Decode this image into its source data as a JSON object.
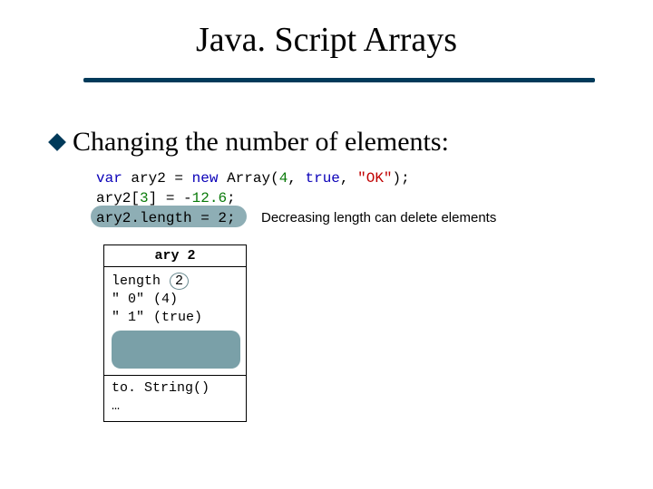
{
  "title": "Java. Script Arrays",
  "bullet": "Changing the number of elements:",
  "code": {
    "kw_var": "var",
    "id_ary2": "ary2",
    "assign": " = ",
    "kw_new": "new",
    "sp": " ",
    "ctor": "Array",
    "open": "(",
    "n4": "4",
    "comma": ", ",
    "kw_true": "true",
    "str_ok": "\"OK\"",
    "close_semi": ");",
    "line2_lhs": "ary2[",
    "line2_idx": "3",
    "line2_rhs1": "] = -",
    "line2_val": "12.6",
    "semi": ";",
    "line3": "ary2.length = 2;"
  },
  "annotation": "Decreasing length can delete elements",
  "obj": {
    "name": "ary 2",
    "rows": [
      {
        "key": "length",
        "val": "2",
        "circled": true
      },
      {
        "key": "\" 0\"",
        "val": "(4)"
      },
      {
        "key": "\" 1\"",
        "val": "(true)"
      }
    ],
    "methods": [
      "to. String()",
      "…"
    ]
  }
}
